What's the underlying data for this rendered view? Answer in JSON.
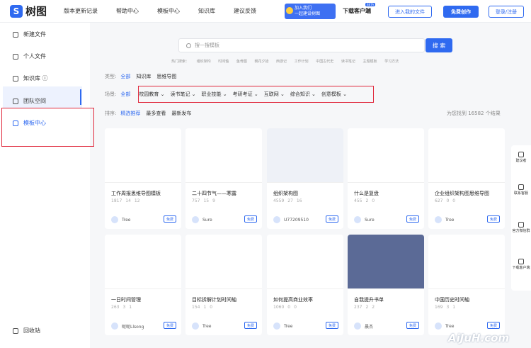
{
  "app": {
    "logo": "S",
    "name": "树图"
  },
  "nav": [
    "版本更新记录",
    "帮助中心",
    "模板中心",
    "知识库",
    "建议反馈"
  ],
  "promo": {
    "line1": "加入我们",
    "line2": "一起建设树图"
  },
  "download": {
    "label": "下载客户端",
    "badge": "BETA"
  },
  "header_buttons": {
    "my_files": "进入我的文件",
    "create": "免费创作",
    "login": "登录/注册"
  },
  "sidebar": {
    "items": [
      {
        "label": "新建文件",
        "icon": "new-file-icon"
      },
      {
        "label": "个人文件",
        "icon": "folder-icon"
      },
      {
        "label": "知识库 ⓘ",
        "icon": "book-icon"
      },
      {
        "label": "团队空间",
        "icon": "team-icon"
      },
      {
        "label": "模板中心",
        "icon": "template-icon"
      }
    ],
    "trash": "回收站"
  },
  "search": {
    "placeholder": "搜一搜模板",
    "button": "搜 索"
  },
  "hot": {
    "label": "热门搜索：",
    "items": [
      "组织架构",
      "时间轴",
      "鱼骨图",
      "朝花夕拾",
      "西游记",
      "工作计划",
      "中国古代史",
      "读书笔记",
      "主题模板",
      "学习方法"
    ]
  },
  "filters": {
    "type": {
      "label": "类型:",
      "items": [
        "全部",
        "知识库",
        "思维导图"
      ]
    },
    "scene": {
      "label": "场景:",
      "all": "全部",
      "items": [
        "校园教育 ⌄",
        "读书笔记 ⌄",
        "职业技能 ⌄",
        "考研考证 ⌄",
        "互联网 ⌄",
        "综合知识 ⌄",
        "创意模板 ⌄"
      ]
    },
    "sort": {
      "label": "排序:",
      "items": [
        "精选推荐",
        "最多查看",
        "最新发布"
      ]
    }
  },
  "total_text": "为您找到 16582 个结果",
  "cards": [
    {
      "title": "工作周报思维导图模板",
      "views": "1817",
      "likes": "14",
      "stars": "12",
      "user": "Tree",
      "free": "免费"
    },
    {
      "title": "二十四节气——寒露",
      "views": "757",
      "likes": "15",
      "stars": "9",
      "user": "Sure",
      "free": "免费"
    },
    {
      "title": "组织架构图",
      "views": "4559",
      "likes": "27",
      "stars": "16",
      "user": "U77209510",
      "free": "免费"
    },
    {
      "title": "什么是复盘",
      "views": "455",
      "likes": "2",
      "stars": "0",
      "user": "Sure",
      "free": "免费"
    },
    {
      "title": "企业组织架构图思维导图",
      "views": "627",
      "likes": "0",
      "stars": "0",
      "user": "Tree",
      "free": "免费"
    },
    {
      "title": "一日时间管理",
      "views": "263",
      "likes": "3",
      "stars": "1",
      "user": "呢呢Llsong",
      "free": "免费"
    },
    {
      "title": "目标拆解计划时间轴",
      "views": "154",
      "likes": "1",
      "stars": "0",
      "user": "Tree",
      "free": "免费"
    },
    {
      "title": "如何提高商业效率",
      "views": "1060",
      "likes": "0",
      "stars": "0",
      "user": "Tree",
      "free": "免费"
    },
    {
      "title": "自我提升书单",
      "views": "237",
      "likes": "2",
      "stars": "2",
      "user": "晨杰",
      "free": "免费"
    },
    {
      "title": "中国历史时间轴",
      "views": "169",
      "likes": "3",
      "stars": "1",
      "user": "Tree",
      "free": "免费"
    }
  ],
  "rail": [
    {
      "label": "建议者",
      "icon": "feedback-icon"
    },
    {
      "label": "联系客服",
      "icon": "headset-icon"
    },
    {
      "label": "官方微信群",
      "icon": "wechat-icon"
    },
    {
      "label": "下载客户端",
      "icon": "download-icon"
    }
  ],
  "watermark": "AiJuH.com",
  "colors": {
    "accent": "#2f6af0",
    "highlight_box": "#e0283c"
  }
}
